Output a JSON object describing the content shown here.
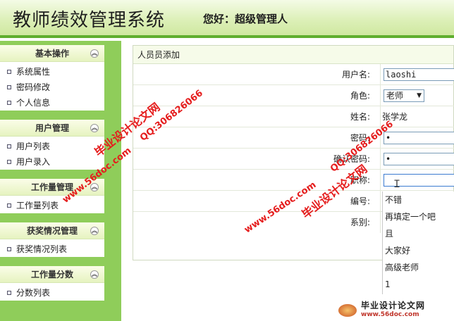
{
  "header": {
    "title": "教师绩效管理系统",
    "welcome": "您好：超级管理人"
  },
  "sidebar": {
    "sections": [
      {
        "title": "基本操作",
        "items": [
          "系统属性",
          "密码修改",
          "个人信息"
        ]
      },
      {
        "title": "用户管理",
        "items": [
          "用户列表",
          "用户录入"
        ]
      },
      {
        "title": "工作量管理",
        "items": [
          "工作量列表"
        ]
      },
      {
        "title": "获奖情况管理",
        "items": [
          "获奖情况列表"
        ]
      },
      {
        "title": "工作量分数",
        "items": [
          "分数列表"
        ]
      }
    ]
  },
  "panel": {
    "title": "人员员添加",
    "fields": {
      "username": {
        "label": "用户名:",
        "value": "laoshi"
      },
      "role": {
        "label": "角色:",
        "value": "老师"
      },
      "name": {
        "label": "姓名:",
        "value": "张学龙"
      },
      "password": {
        "label": "密码:",
        "value": "•"
      },
      "confirm": {
        "label": "确认密码:",
        "value": "•"
      },
      "title": {
        "label": "职称:",
        "value": ""
      },
      "code": {
        "label": "编号:"
      },
      "dept": {
        "label": "系别:"
      }
    }
  },
  "autocomplete": [
    "不错",
    "再填定一个吧",
    "且",
    "大家好",
    "高级老师",
    "1"
  ],
  "watermarks": {
    "left_site": "www.56doc.com",
    "left_brand": "毕业设计论文网",
    "left_qq": "QQ:306826066",
    "right_site": "www.56doc.com",
    "right_brand": "毕业设计论文网",
    "right_qq": "QQ:306826066"
  },
  "logo": {
    "text": "毕业设计论文网",
    "url": "www.56doc.com"
  },
  "colors": {
    "accent": "#5fae2e",
    "sidebar": "#8fcd5a",
    "watermark": "#e51d1d"
  }
}
